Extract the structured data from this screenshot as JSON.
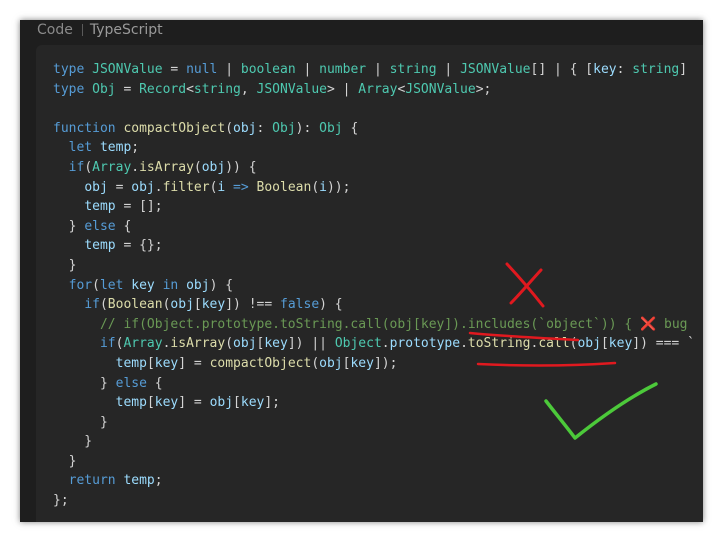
{
  "header": {
    "label": "Code",
    "language": "TypeScript"
  },
  "code": {
    "lines": [
      [
        [
          "kw",
          "type"
        ],
        [
          "pl",
          " "
        ],
        [
          "ty",
          "JSONValue"
        ],
        [
          "pl",
          " = "
        ],
        [
          "kw",
          "null"
        ],
        [
          "pl",
          " | "
        ],
        [
          "ty",
          "boolean"
        ],
        [
          "pl",
          " | "
        ],
        [
          "ty",
          "number"
        ],
        [
          "pl",
          " | "
        ],
        [
          "ty",
          "string"
        ],
        [
          "pl",
          " | "
        ],
        [
          "ty",
          "JSONValue"
        ],
        [
          "pl",
          "[] | { ["
        ],
        [
          "va",
          "key"
        ],
        [
          "pl",
          ": "
        ],
        [
          "ty",
          "string"
        ],
        [
          "pl",
          "]"
        ]
      ],
      [
        [
          "kw",
          "type"
        ],
        [
          "pl",
          " "
        ],
        [
          "ty",
          "Obj"
        ],
        [
          "pl",
          " = "
        ],
        [
          "ty",
          "Record"
        ],
        [
          "pl",
          "<"
        ],
        [
          "ty",
          "string"
        ],
        [
          "pl",
          ", "
        ],
        [
          "ty",
          "JSONValue"
        ],
        [
          "pl",
          "> | "
        ],
        [
          "ty",
          "Array"
        ],
        [
          "pl",
          "<"
        ],
        [
          "ty",
          "JSONValue"
        ],
        [
          "pl",
          ">;"
        ]
      ],
      [
        [
          "pl",
          ""
        ]
      ],
      [
        [
          "kw",
          "function"
        ],
        [
          "pl",
          " "
        ],
        [
          "fn",
          "compactObject"
        ],
        [
          "pl",
          "("
        ],
        [
          "va",
          "obj"
        ],
        [
          "pl",
          ": "
        ],
        [
          "ty",
          "Obj"
        ],
        [
          "pl",
          "): "
        ],
        [
          "ty",
          "Obj"
        ],
        [
          "pl",
          " {"
        ]
      ],
      [
        [
          "pl",
          "  "
        ],
        [
          "kw",
          "let"
        ],
        [
          "pl",
          " "
        ],
        [
          "va",
          "temp"
        ],
        [
          "pl",
          ";"
        ]
      ],
      [
        [
          "pl",
          "  "
        ],
        [
          "kw",
          "if"
        ],
        [
          "pl",
          "("
        ],
        [
          "ty",
          "Array"
        ],
        [
          "pl",
          "."
        ],
        [
          "fn",
          "isArray"
        ],
        [
          "pl",
          "("
        ],
        [
          "va",
          "obj"
        ],
        [
          "pl",
          ")) {"
        ]
      ],
      [
        [
          "pl",
          "    "
        ],
        [
          "va",
          "obj"
        ],
        [
          "pl",
          " = "
        ],
        [
          "va",
          "obj"
        ],
        [
          "pl",
          "."
        ],
        [
          "fn",
          "filter"
        ],
        [
          "pl",
          "("
        ],
        [
          "va",
          "i"
        ],
        [
          "pl",
          " "
        ],
        [
          "kw",
          "=>"
        ],
        [
          "pl",
          " "
        ],
        [
          "fn",
          "Boolean"
        ],
        [
          "pl",
          "("
        ],
        [
          "va",
          "i"
        ],
        [
          "pl",
          "));"
        ]
      ],
      [
        [
          "pl",
          "    "
        ],
        [
          "va",
          "temp"
        ],
        [
          "pl",
          " = [];"
        ]
      ],
      [
        [
          "pl",
          "  } "
        ],
        [
          "kw",
          "else"
        ],
        [
          "pl",
          " {"
        ]
      ],
      [
        [
          "pl",
          "    "
        ],
        [
          "va",
          "temp"
        ],
        [
          "pl",
          " = {};"
        ]
      ],
      [
        [
          "pl",
          "  }"
        ]
      ],
      [
        [
          "pl",
          "  "
        ],
        [
          "kw",
          "for"
        ],
        [
          "pl",
          "("
        ],
        [
          "kw",
          "let"
        ],
        [
          "pl",
          " "
        ],
        [
          "va",
          "key"
        ],
        [
          "pl",
          " "
        ],
        [
          "kw",
          "in"
        ],
        [
          "pl",
          " "
        ],
        [
          "va",
          "obj"
        ],
        [
          "pl",
          ") {"
        ]
      ],
      [
        [
          "pl",
          "    "
        ],
        [
          "kw",
          "if"
        ],
        [
          "pl",
          "("
        ],
        [
          "fn",
          "Boolean"
        ],
        [
          "pl",
          "("
        ],
        [
          "va",
          "obj"
        ],
        [
          "pl",
          "["
        ],
        [
          "va",
          "key"
        ],
        [
          "pl",
          "]) !== "
        ],
        [
          "nu",
          "false"
        ],
        [
          "pl",
          ") {"
        ]
      ],
      [
        [
          "pl",
          "      "
        ],
        [
          "cm",
          "// if(Object.prototype.toString.call(obj[key]).includes(`object`)) { ❌ bug"
        ]
      ],
      [
        [
          "pl",
          "      "
        ],
        [
          "kw",
          "if"
        ],
        [
          "pl",
          "("
        ],
        [
          "ty",
          "Array"
        ],
        [
          "pl",
          "."
        ],
        [
          "fn",
          "isArray"
        ],
        [
          "pl",
          "("
        ],
        [
          "va",
          "obj"
        ],
        [
          "pl",
          "["
        ],
        [
          "va",
          "key"
        ],
        [
          "pl",
          "]) || "
        ],
        [
          "ty",
          "Object"
        ],
        [
          "pl",
          "."
        ],
        [
          "va",
          "prototype"
        ],
        [
          "pl",
          "."
        ],
        [
          "fn",
          "toString"
        ],
        [
          "pl",
          "."
        ],
        [
          "fn",
          "call"
        ],
        [
          "pl",
          "("
        ],
        [
          "va",
          "obj"
        ],
        [
          "pl",
          "["
        ],
        [
          "va",
          "key"
        ],
        [
          "pl",
          "]) === `"
        ]
      ],
      [
        [
          "pl",
          "        "
        ],
        [
          "va",
          "temp"
        ],
        [
          "pl",
          "["
        ],
        [
          "va",
          "key"
        ],
        [
          "pl",
          "] = "
        ],
        [
          "fn",
          "compactObject"
        ],
        [
          "pl",
          "("
        ],
        [
          "va",
          "obj"
        ],
        [
          "pl",
          "["
        ],
        [
          "va",
          "key"
        ],
        [
          "pl",
          "]);"
        ]
      ],
      [
        [
          "pl",
          "      } "
        ],
        [
          "kw",
          "else"
        ],
        [
          "pl",
          " {"
        ]
      ],
      [
        [
          "pl",
          "        "
        ],
        [
          "va",
          "temp"
        ],
        [
          "pl",
          "["
        ],
        [
          "va",
          "key"
        ],
        [
          "pl",
          "] = "
        ],
        [
          "va",
          "obj"
        ],
        [
          "pl",
          "["
        ],
        [
          "va",
          "key"
        ],
        [
          "pl",
          "];"
        ]
      ],
      [
        [
          "pl",
          "      }"
        ]
      ],
      [
        [
          "pl",
          "    }"
        ]
      ],
      [
        [
          "pl",
          "  }"
        ]
      ],
      [
        [
          "pl",
          "  "
        ],
        [
          "kw",
          "return"
        ],
        [
          "pl",
          " "
        ],
        [
          "va",
          "temp"
        ],
        [
          "pl",
          ";"
        ]
      ],
      [
        [
          "pl",
          "};"
        ]
      ]
    ]
  },
  "annotations": {
    "cross_color": "#e0191f",
    "underline_color": "#e0191f",
    "check_color": "#4cc93a"
  }
}
